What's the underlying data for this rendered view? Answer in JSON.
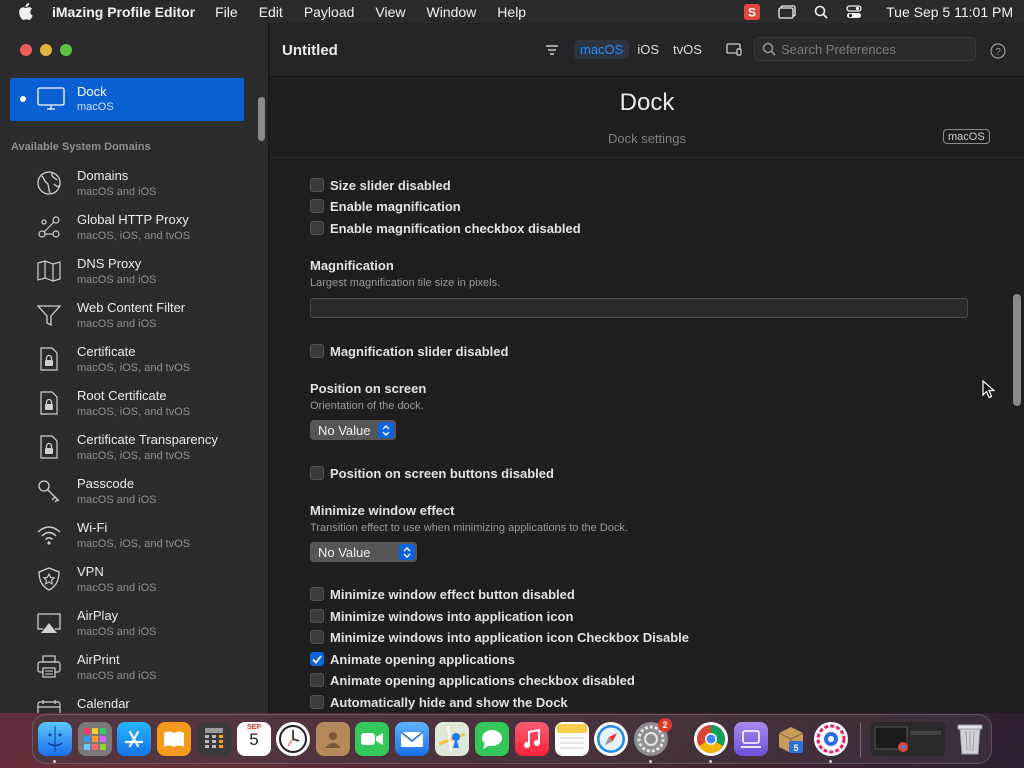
{
  "menubar": {
    "app_name": "iMazing Profile Editor",
    "menus": [
      "File",
      "Edit",
      "Payload",
      "View",
      "Window",
      "Help"
    ],
    "clock": "Tue Sep 5  11:01 PM"
  },
  "toolbar": {
    "document_title": "Untitled",
    "platform_tabs": [
      "macOS",
      "iOS",
      "tvOS"
    ],
    "active_tab": "macOS",
    "search_placeholder": "Search Preferences"
  },
  "sidebar": {
    "selected": {
      "title": "Dock",
      "subtitle": "macOS"
    },
    "section_heading": "Available System Domains",
    "items": [
      {
        "title": "Domains",
        "subtitle": "macOS and iOS",
        "icon": "globe-icon"
      },
      {
        "title": "Global HTTP Proxy",
        "subtitle": "macOS, iOS, and tvOS",
        "icon": "network-nodes-icon"
      },
      {
        "title": "DNS Proxy",
        "subtitle": "macOS and iOS",
        "icon": "map-icon"
      },
      {
        "title": "Web Content Filter",
        "subtitle": "macOS and iOS",
        "icon": "funnel-icon"
      },
      {
        "title": "Certificate",
        "subtitle": "macOS, iOS, and tvOS",
        "icon": "certificate-lock-icon"
      },
      {
        "title": "Root Certificate",
        "subtitle": "macOS, iOS, and tvOS",
        "icon": "certificate-lock-icon"
      },
      {
        "title": "Certificate Transparency",
        "subtitle": "macOS, iOS, and tvOS",
        "icon": "certificate-lock-icon"
      },
      {
        "title": "Passcode",
        "subtitle": "macOS and iOS",
        "icon": "key-icon"
      },
      {
        "title": "Wi-Fi",
        "subtitle": "macOS, iOS, and tvOS",
        "icon": "wifi-icon"
      },
      {
        "title": "VPN",
        "subtitle": "macOS and iOS",
        "icon": "shield-icon"
      },
      {
        "title": "AirPlay",
        "subtitle": "macOS and iOS",
        "icon": "airplay-icon"
      },
      {
        "title": "AirPrint",
        "subtitle": "macOS and iOS",
        "icon": "printer-icon"
      },
      {
        "title": "Calendar",
        "subtitle": "",
        "icon": "calendar-icon"
      }
    ]
  },
  "payload": {
    "title": "Dock",
    "description": "Dock settings",
    "platform_badge": "macOS"
  },
  "settings": {
    "size_slider_disabled": {
      "label": "Size slider disabled",
      "checked": false
    },
    "enable_magnification": {
      "label": "Enable magnification",
      "checked": false
    },
    "enable_magnification_cb_disabled": {
      "label": "Enable magnification checkbox disabled",
      "checked": false
    },
    "magnification": {
      "title": "Magnification",
      "description": "Largest magnification tile size in pixels.",
      "value": ""
    },
    "magnification_slider_disabled": {
      "label": "Magnification slider disabled",
      "checked": false
    },
    "position_on_screen": {
      "title": "Position on screen",
      "description": "Orientation of the dock.",
      "value": "No Value"
    },
    "position_buttons_disabled": {
      "label": "Position on screen buttons disabled",
      "checked": false
    },
    "minimize_effect": {
      "title": "Minimize window effect",
      "description": "Transition effect to use when minimizing applications to the Dock.",
      "value": "No Value"
    },
    "minimize_effect_button_disabled": {
      "label": "Minimize window effect button disabled",
      "checked": false
    },
    "minimize_into_icon": {
      "label": "Minimize windows into application icon",
      "checked": false
    },
    "minimize_into_icon_cb_disable": {
      "label": "Minimize windows into application icon Checkbox Disable",
      "checked": false
    },
    "animate_opening": {
      "label": "Animate opening applications",
      "checked": true
    },
    "animate_opening_cb_disabled": {
      "label": "Animate opening applications checkbox disabled",
      "checked": false
    },
    "autohide": {
      "label": "Automatically hide and show the Dock",
      "checked": false
    }
  },
  "dock": {
    "calendar_month": "SEP",
    "calendar_day": "5",
    "settings_badge": "2",
    "apps": [
      "finder",
      "launchpad",
      "app-store",
      "books",
      "calculator",
      "calendar",
      "clock",
      "contacts",
      "facetime",
      "mail",
      "maps",
      "messages",
      "music",
      "notes",
      "safari",
      "system-settings",
      "chrome",
      "imazing",
      "archive-utility",
      "imazing-profile-editor",
      "recent-window",
      "trash"
    ]
  },
  "colors": {
    "accent": "#0a64e0",
    "sidebar_bg": "#2c2c2f",
    "content_bg": "#1f1f21"
  }
}
